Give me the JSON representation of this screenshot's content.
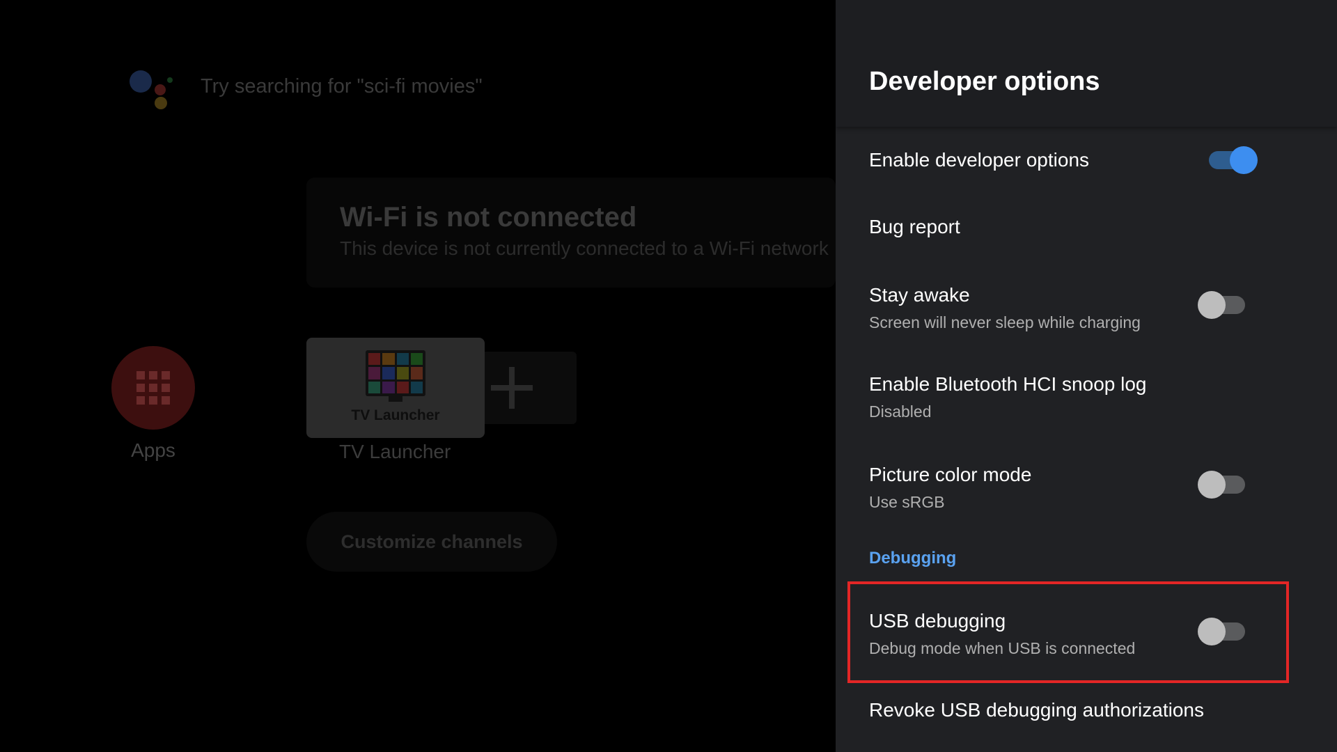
{
  "home": {
    "search_hint": "Try searching for \"sci-fi movies\"",
    "wifi_title": "Wi-Fi is not connected",
    "wifi_subtitle": "This device is not currently connected to a Wi-Fi network",
    "apps_label": "Apps",
    "tile_name": "TV Launcher",
    "launcher_label": "TV Launcher",
    "customize_label": "Customize channels"
  },
  "panel": {
    "title": "Developer options",
    "items": [
      {
        "title": "Enable developer options",
        "toggle": "on"
      },
      {
        "title": "Bug report"
      },
      {
        "title": "Stay awake",
        "subtitle": "Screen will never sleep while charging",
        "toggle": "off"
      },
      {
        "title": "Enable Bluetooth HCI snoop log",
        "subtitle": "Disabled"
      },
      {
        "title": "Picture color mode",
        "subtitle": "Use sRGB",
        "toggle": "off"
      },
      {
        "title": "USB debugging",
        "subtitle": "Debug mode when USB is connected",
        "toggle": "off"
      },
      {
        "title": "Revoke USB debugging authorizations"
      }
    ],
    "section_header": "Debugging"
  },
  "colors": {
    "panel_bg": "#202124",
    "accent_blue": "#3d8ef0",
    "section_header": "#5aa2f0",
    "highlight_red": "#e32626"
  }
}
